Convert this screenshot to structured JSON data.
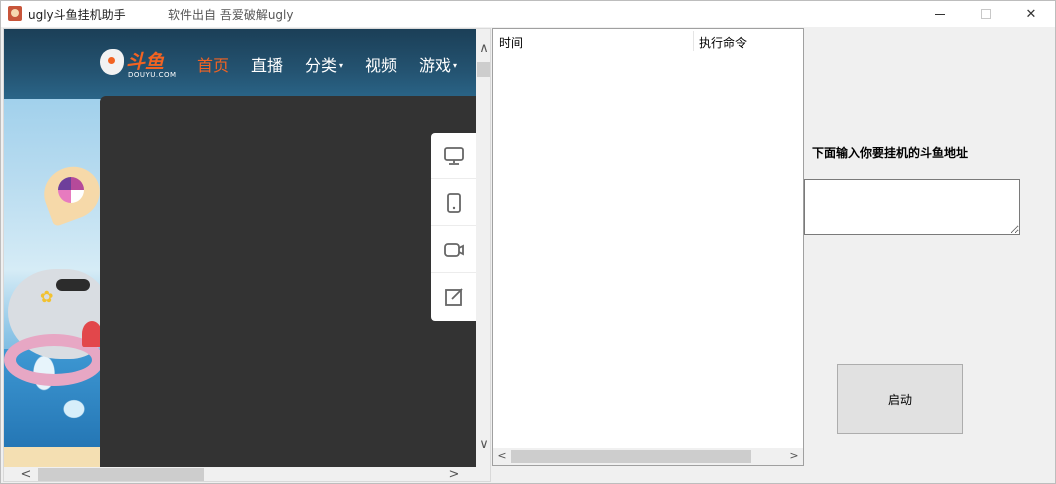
{
  "window": {
    "title": "ugly斗鱼挂机助手",
    "subtitle": "软件出自 吾爱破解ugly",
    "controls": {
      "minimize": "",
      "maximize": "",
      "close": "✕"
    }
  },
  "browser": {
    "logo": {
      "text_cn": "斗鱼",
      "text_en": "DOUYU.COM"
    },
    "nav": [
      {
        "label": "首页",
        "active": true
      },
      {
        "label": "直播"
      },
      {
        "label": "分类",
        "dropdown": "▾"
      },
      {
        "label": "视频"
      },
      {
        "label": "游戏",
        "dropdown": "▾"
      }
    ],
    "side_tools": [
      "monitor-icon",
      "phone-icon",
      "video-icon",
      "edit-icon"
    ],
    "scroll": {
      "up": "∧",
      "down": "∨",
      "left": "<",
      "right": ">"
    }
  },
  "log_list": {
    "columns": [
      "时间",
      "执行命令"
    ],
    "rows": [],
    "scroll": {
      "left": "<",
      "right": ">"
    }
  },
  "panel": {
    "url_label": "下面输入你要挂机的斗鱼地址",
    "url_value": "",
    "start_button": "启动"
  },
  "colors": {
    "brand_orange": "#f26322",
    "window_bg": "#f0f0f0",
    "dark_panel": "#333333"
  }
}
